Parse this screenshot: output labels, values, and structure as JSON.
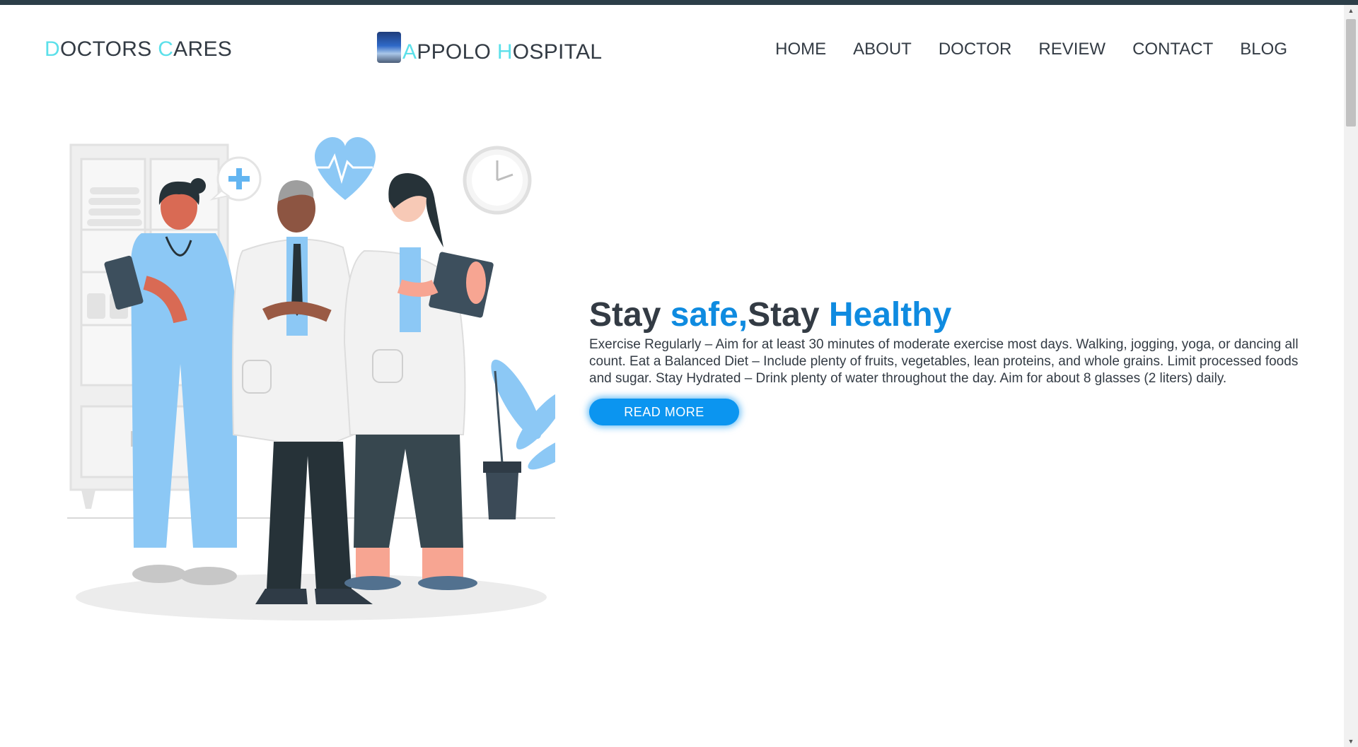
{
  "header": {
    "left_brand": {
      "first": "D",
      "mid1": "OCTORS ",
      "accent2": "C",
      "rest": "ARES"
    },
    "center_brand": {
      "first": "A",
      "mid1": "PPOLO ",
      "accent2": "H",
      "rest": "OSPITAL"
    },
    "nav": [
      "HOME",
      "ABOUT",
      "DOCTOR",
      "REVIEW",
      "CONTACT",
      "BLOG"
    ]
  },
  "hero": {
    "title_part1": "Stay ",
    "title_part2": "safe,",
    "title_part3": "Stay ",
    "title_part4": "Healthy",
    "description": "Exercise Regularly – Aim for at least 30 minutes of moderate exercise most days. Walking, jogging, yoga, or dancing all count. Eat a Balanced Diet – Include plenty of fruits, vegetables, lean proteins, and whole grains. Limit processed foods and sugar. Stay Hydrated – Drink plenty of water throughout the day. Aim for about 8 glasses (2 liters) daily.",
    "button_label": "READ MORE"
  },
  "colors": {
    "accent_cyan": "#5ce0ea",
    "title_blue": "#0f8be0",
    "button_blue": "#0b95f0",
    "text_dark": "#333b44"
  }
}
